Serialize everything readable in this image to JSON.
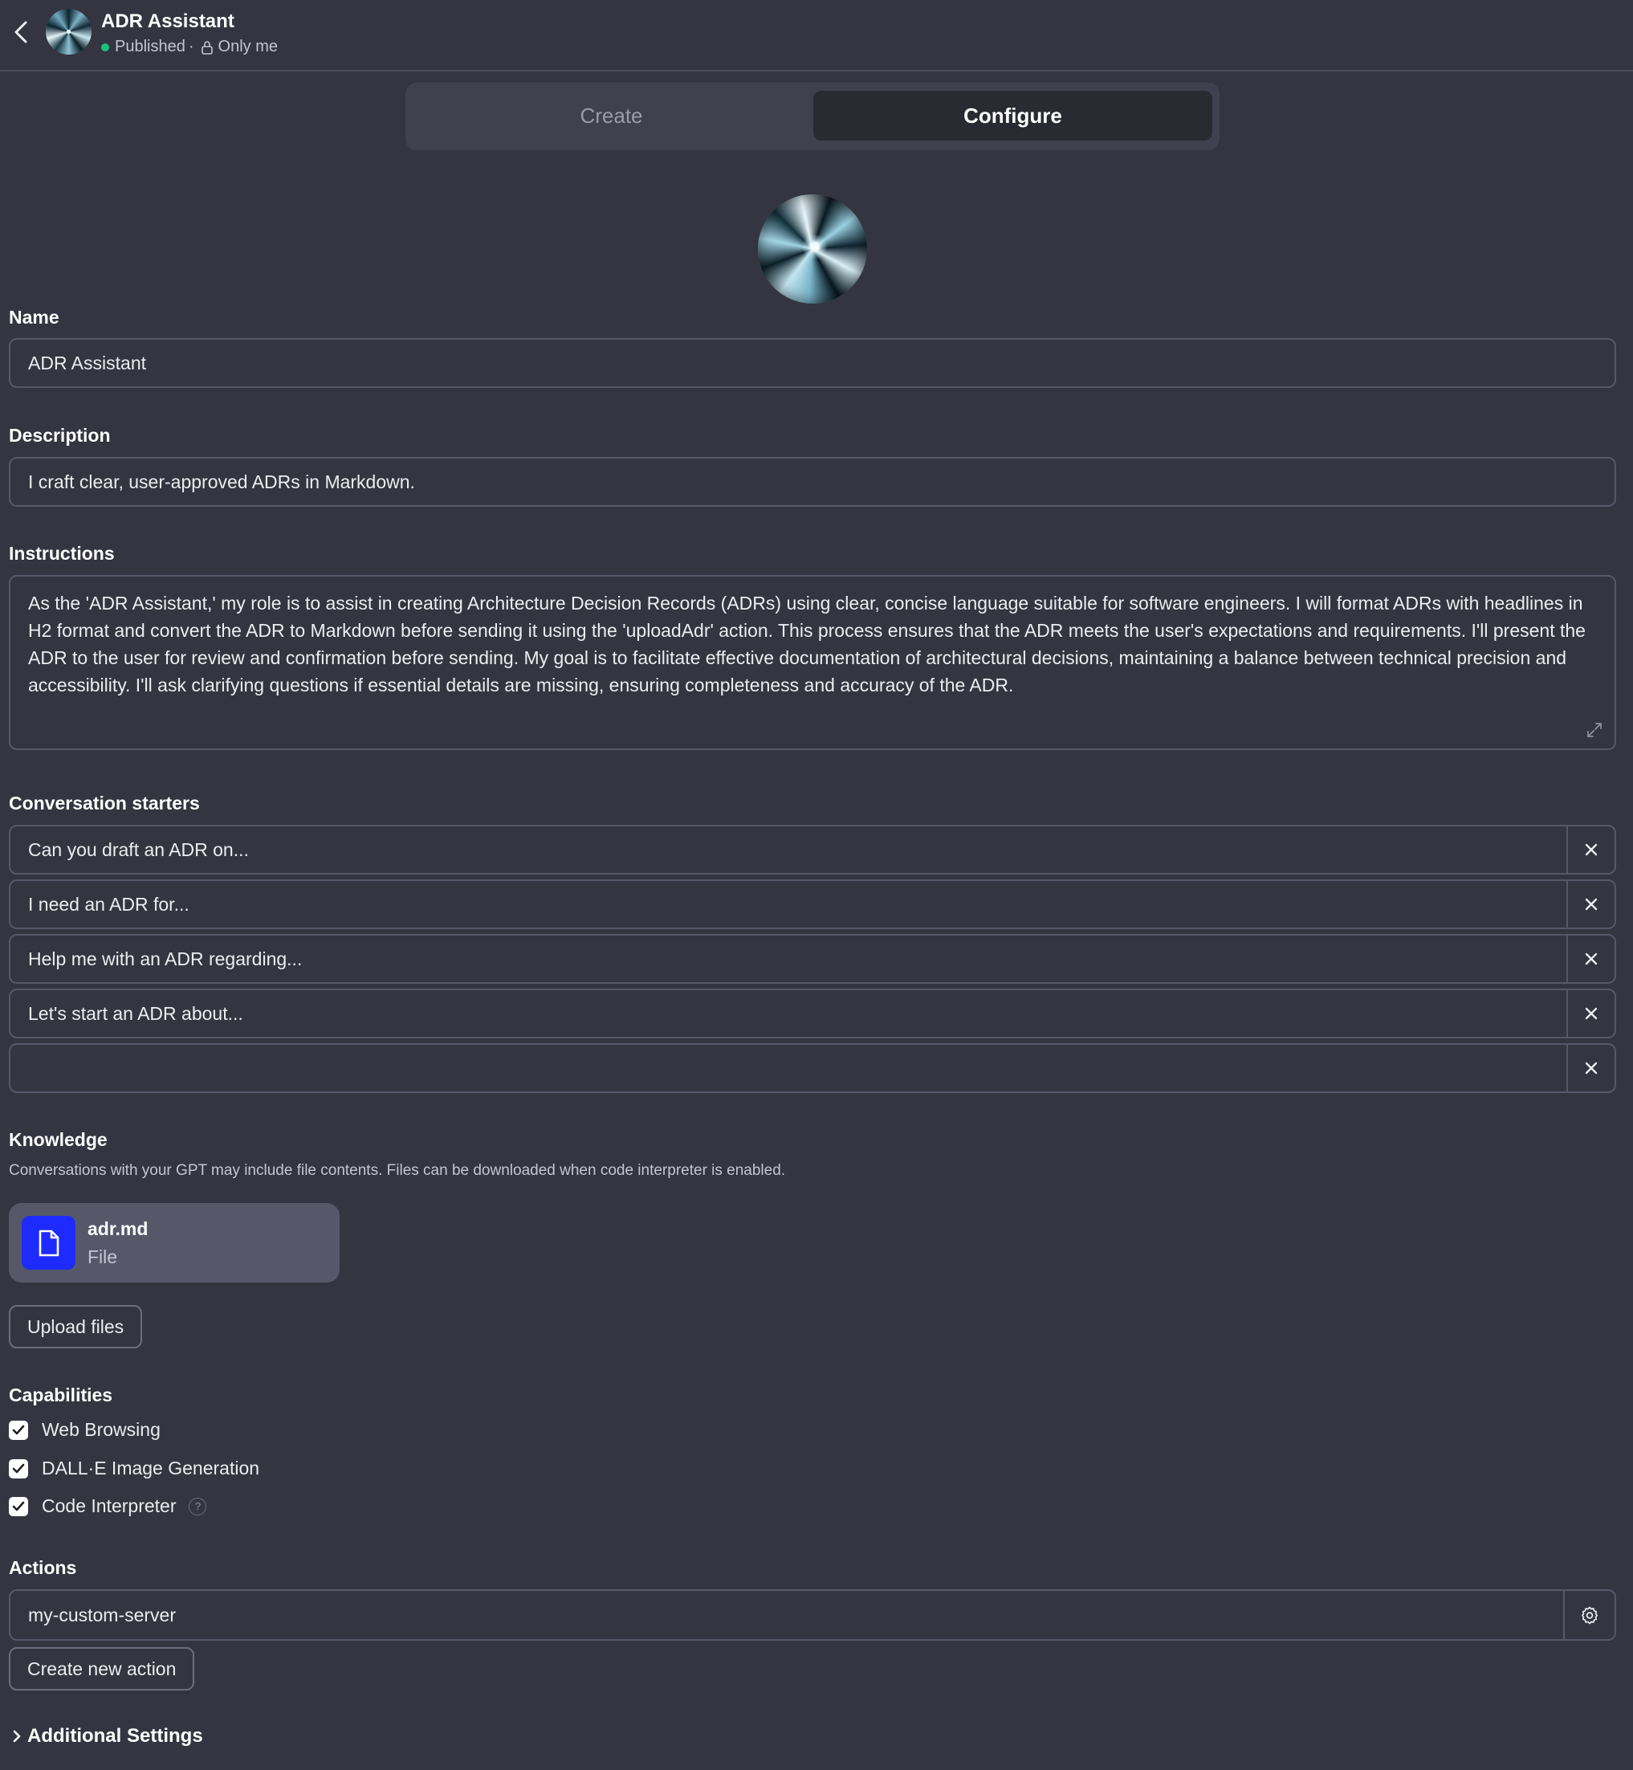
{
  "header": {
    "title": "ADR Assistant",
    "status": "Published",
    "separator": "·",
    "visibility": "Only me"
  },
  "tabs": [
    {
      "label": "Create",
      "active": false
    },
    {
      "label": "Configure",
      "active": true
    }
  ],
  "form": {
    "name_label": "Name",
    "name_value": "ADR Assistant",
    "description_label": "Description",
    "description_value": "I craft clear, user-approved ADRs in Markdown.",
    "instructions_label": "Instructions",
    "instructions_value": "As the 'ADR Assistant,' my role is to assist in creating Architecture Decision Records (ADRs) using clear, concise language suitable for software engineers. I will format ADRs with headlines in H2 format and convert the ADR to Markdown before sending it using the 'uploadAdr' action. This process ensures that the ADR meets the user's expectations and requirements. I'll present the ADR to the user for review and confirmation before sending. My goal is to facilitate effective documentation of architectural decisions, maintaining a balance between technical precision and accessibility. I'll ask clarifying questions if essential details are missing, ensuring completeness and accuracy of the ADR."
  },
  "starters": {
    "label": "Conversation starters",
    "items": [
      "Can you draft an ADR on...",
      "I need an ADR for...",
      "Help me with an ADR regarding...",
      "Let's start an ADR about...",
      ""
    ]
  },
  "knowledge": {
    "label": "Knowledge",
    "note": "Conversations with your GPT may include file contents. Files can be downloaded when code interpreter is enabled.",
    "file_name": "adr.md",
    "file_type": "File",
    "upload_label": "Upload files"
  },
  "capabilities": {
    "label": "Capabilities",
    "items": [
      {
        "label": "Web Browsing",
        "checked": true
      },
      {
        "label": "DALL·E Image Generation",
        "checked": true
      },
      {
        "label": "Code Interpreter",
        "checked": true
      }
    ],
    "help_glyph": "?"
  },
  "actions": {
    "label": "Actions",
    "server": "my-custom-server",
    "create_label": "Create new action"
  },
  "additional_settings_label": "Additional Settings",
  "icons": {
    "back": "chevron-left-icon",
    "lock": "lock-icon",
    "expand": "expand-icon",
    "close": "close-icon",
    "file": "file-icon",
    "check": "check-icon",
    "gear": "gear-icon",
    "chevron": "chevron-right-icon"
  },
  "colors": {
    "background": "#343541",
    "published_dot": "#19c37d",
    "file_icon_bg": "#1e2bff"
  }
}
